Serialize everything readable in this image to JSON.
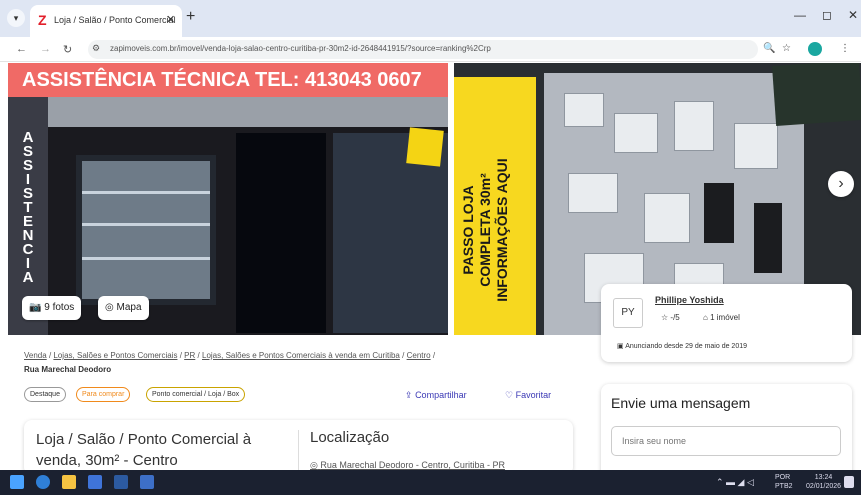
{
  "browser": {
    "tab_title": "Loja / Salão / Ponto Comercial",
    "tab_close": "✕",
    "new_tab": "+",
    "url": "zapimoveis.com.br/imovel/venda-loja-salao-centro-curitiba-pr-30m2-id-2648441915/?source=ranking%2Crp",
    "window_min": "—",
    "window_max": "◻",
    "window_close": "✕"
  },
  "gallery": {
    "banner_text": "ASSISTÊNCIA TÉCNICA TEL: 413043 0607",
    "vertical_text": "ASSISTENCIA",
    "banner2_text": "PASSO LOJA\nCOMPLETA 30m²\nINFORMAÇÕES AQUI",
    "photos_label": "9 fotos",
    "map_label": "Mapa",
    "next_label": "›"
  },
  "breadcrumb": {
    "items": [
      "Venda",
      "Lojas, Salões e Pontos Comerciais",
      "PR",
      "Lojas, Salões e Pontos Comerciais à venda em Curitiba",
      "Centro"
    ],
    "separator": "/",
    "current": "Rua Marechal Deodoro"
  },
  "tags": [
    "Destaque",
    "Para comprar",
    "Ponto comercial / Loja / Box"
  ],
  "actions": {
    "share": "Compartilhar",
    "favorite": "Favoritar"
  },
  "listing": {
    "title": "Loja / Salão / Ponto Comercial à venda, 30m² - Centro",
    "location_title": "Localização",
    "address": "Rua Marechal Deodoro - Centro, Curitiba - PR"
  },
  "advertiser": {
    "initials": "PY",
    "name": "Phillipe Yoshida",
    "rating": "-/5",
    "properties": "1 imóvel",
    "since": "Anunciando desde 29 de maio de 2019"
  },
  "message": {
    "title": "Envie uma mensagem",
    "name_placeholder": "Insira seu nome"
  },
  "taskbar": {
    "lang": "POR",
    "lang2": "PTB2",
    "time": "13:24",
    "date": "02/01/2026"
  },
  "colors": {
    "brand_red": "#e21f2a",
    "link_purple": "#3b39b5",
    "tag_orange": "#f08a1c",
    "tag_yellow": "#c9a300"
  }
}
